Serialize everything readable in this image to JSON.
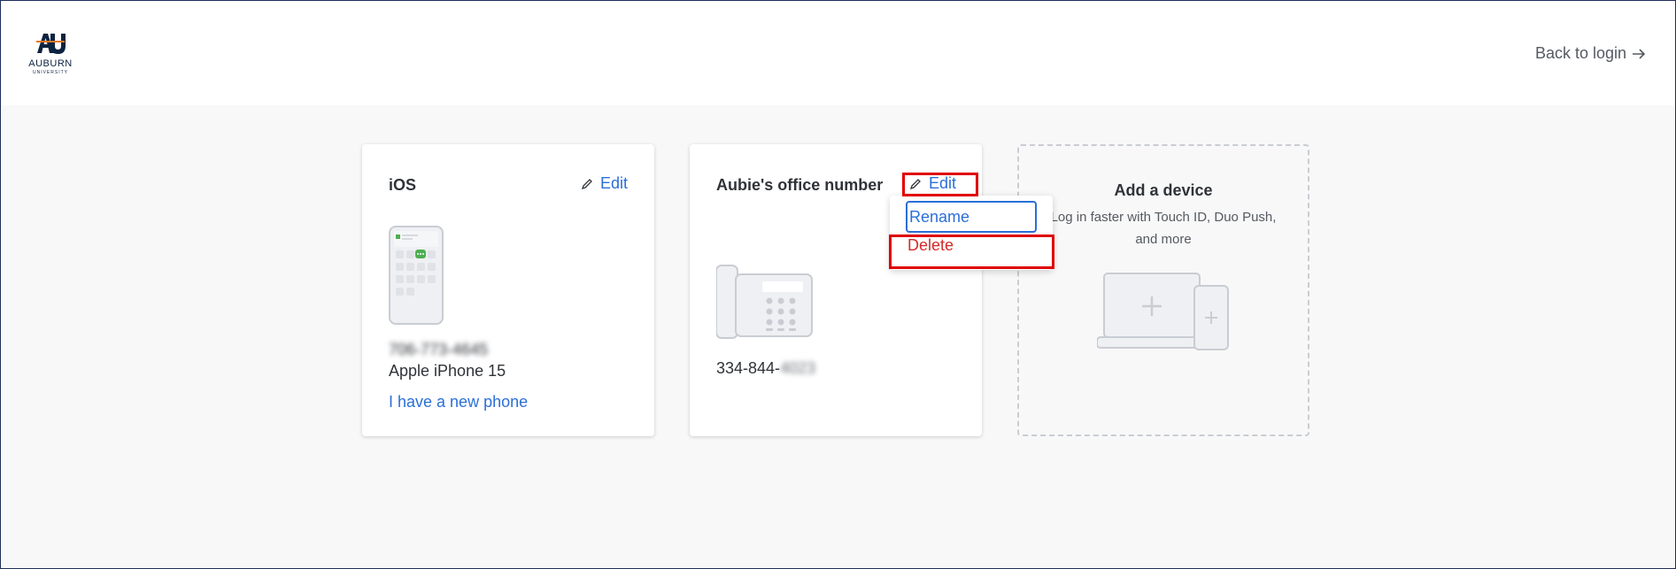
{
  "header": {
    "logo_text": "AUBURN",
    "logo_subtext": "UNIVERSITY",
    "back_link": "Back to login"
  },
  "devices": [
    {
      "title": "iOS",
      "edit_label": "Edit",
      "phone_number": "706-773-4645",
      "model": "Apple iPhone 15",
      "new_phone_link": "I have a new phone"
    },
    {
      "title": "Aubie's office number",
      "edit_label": "Edit",
      "number_prefix": "334-844-",
      "number_suffix": "4023"
    }
  ],
  "add_device": {
    "title": "Add a device",
    "subtitle": "Log in faster with Touch ID, Duo Push, and more"
  },
  "menu": {
    "rename": "Rename",
    "delete": "Delete"
  },
  "colors": {
    "link": "#2b6fd8",
    "danger": "#d22b2b",
    "highlight": "#e00000",
    "brand_navy": "#0c2340",
    "brand_orange": "#e87722"
  }
}
